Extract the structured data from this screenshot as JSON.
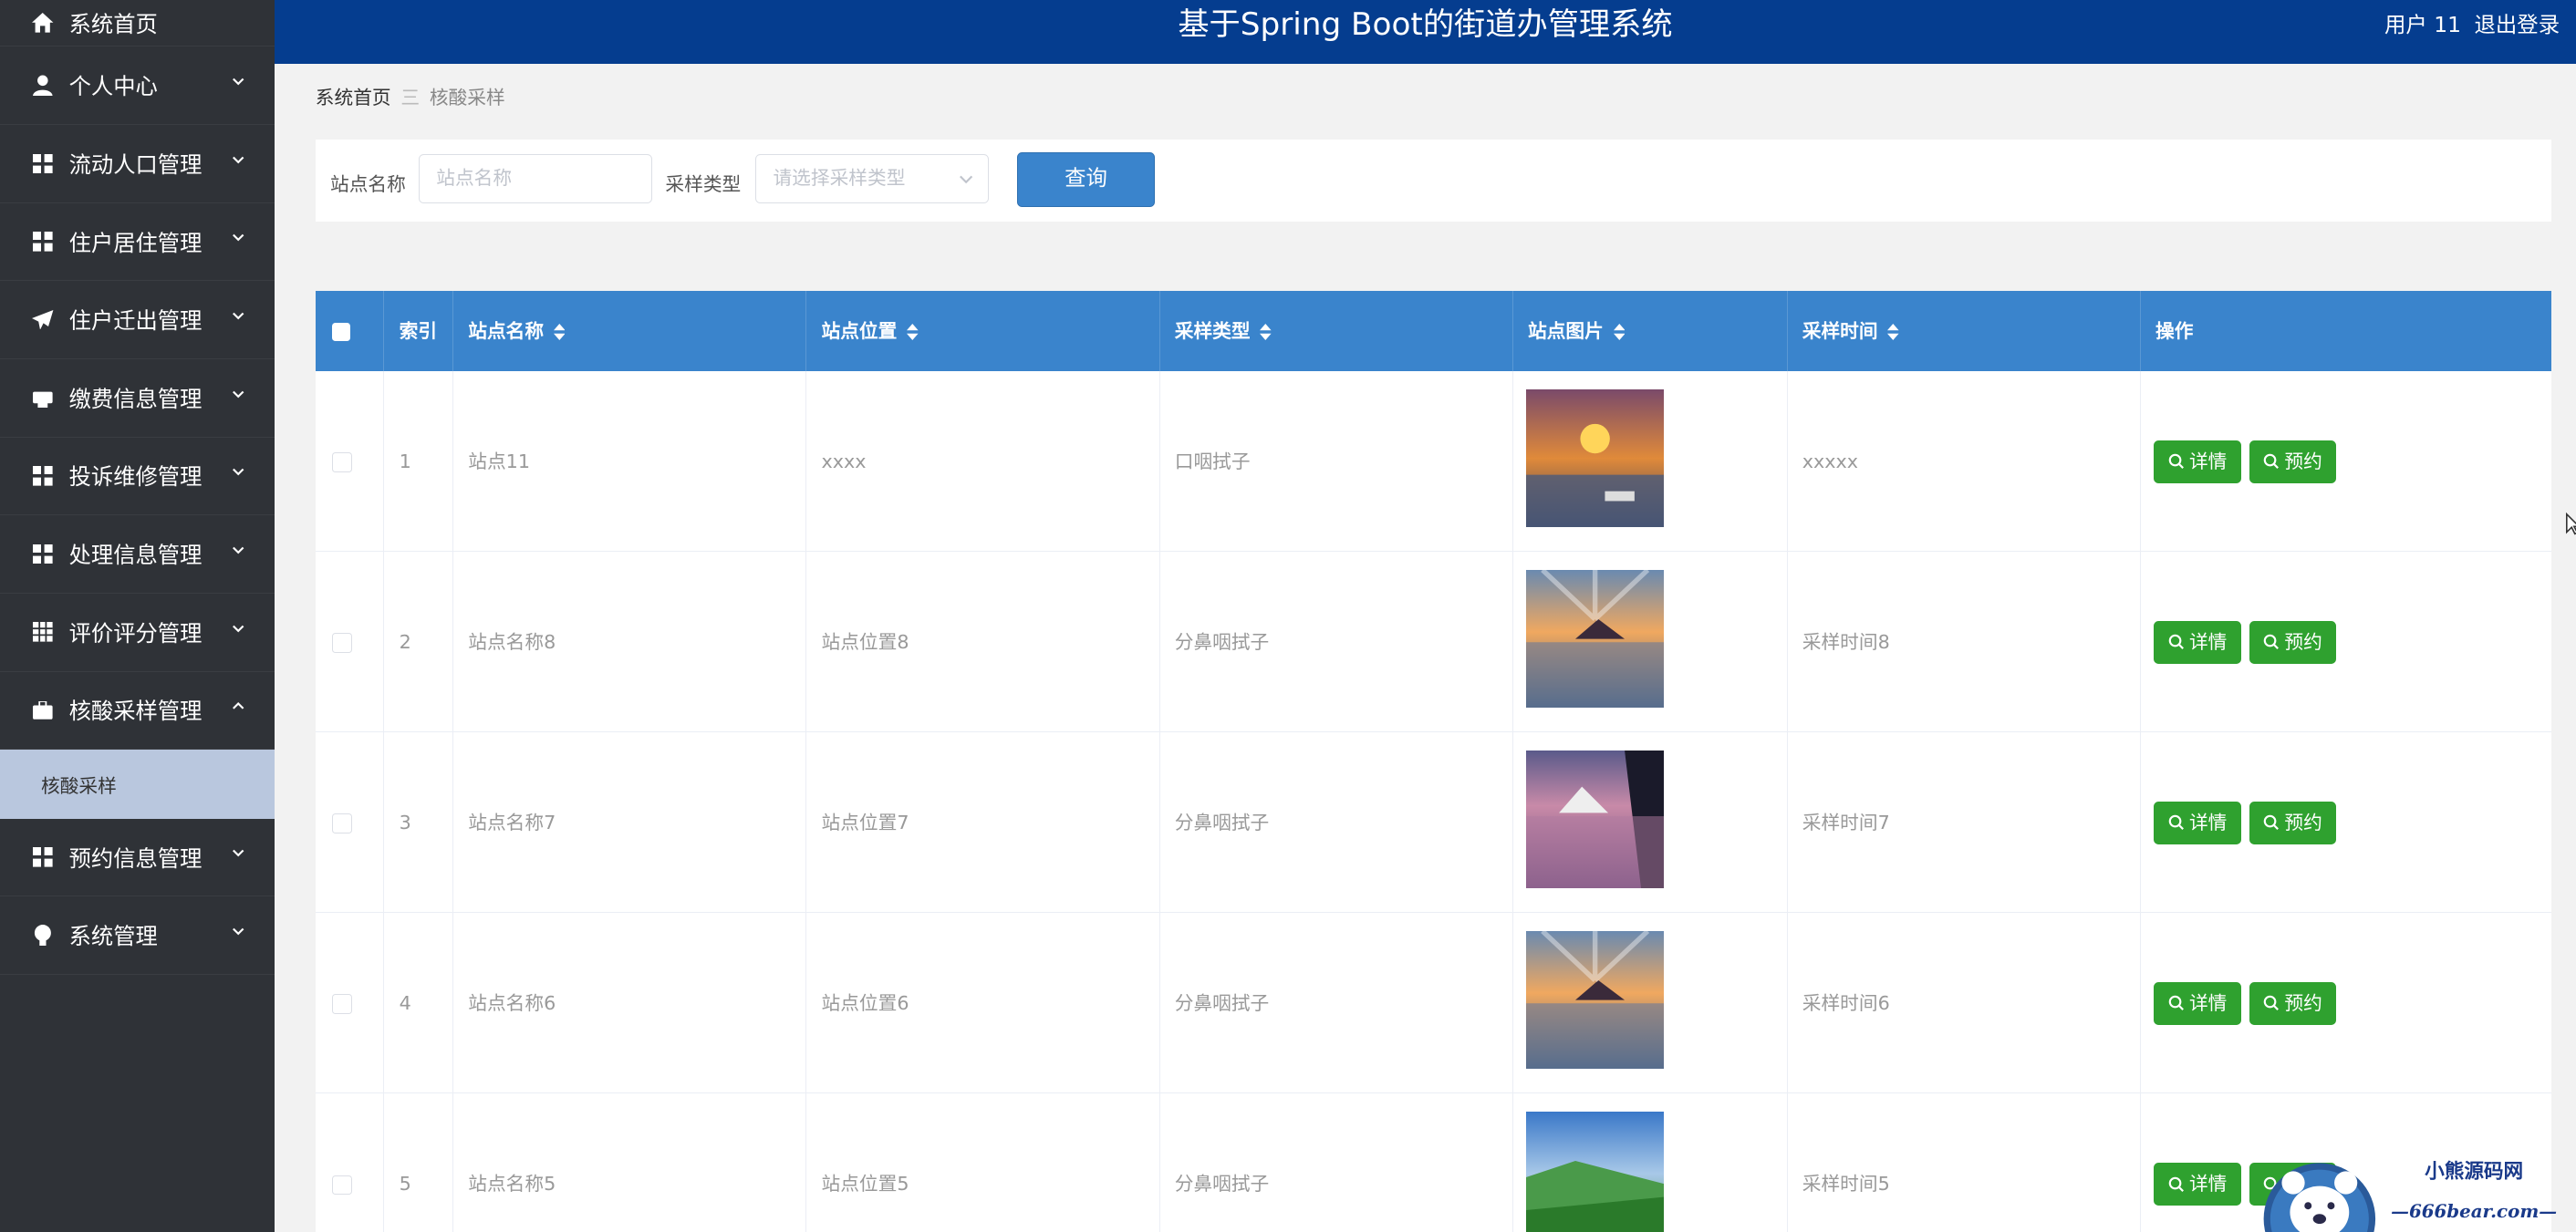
{
  "header": {
    "title": "基于Spring Boot的街道办管理系统",
    "user": "用户 11",
    "logout": "退出登录"
  },
  "sidebar": {
    "items": [
      {
        "label": "系统首页",
        "icon": "home-icon"
      },
      {
        "label": "个人中心",
        "icon": "user-icon"
      },
      {
        "label": "流动人口管理",
        "icon": "grid-icon"
      },
      {
        "label": "住户居住管理",
        "icon": "grid-icon"
      },
      {
        "label": "住户迁出管理",
        "icon": "send-icon"
      },
      {
        "label": "缴费信息管理",
        "icon": "print-icon"
      },
      {
        "label": "投诉维修管理",
        "icon": "grid-icon"
      },
      {
        "label": "处理信息管理",
        "icon": "grid-icon"
      },
      {
        "label": "评价评分管理",
        "icon": "table-icon"
      },
      {
        "label": "核酸采样管理",
        "icon": "briefcase-icon",
        "expanded": true
      },
      {
        "label": "预约信息管理",
        "icon": "grid-icon"
      },
      {
        "label": "系统管理",
        "icon": "bulb-icon"
      }
    ],
    "sub_item": "核酸采样"
  },
  "breadcrumb": {
    "home": "系统首页",
    "sep": "三",
    "current": "核酸采样"
  },
  "search": {
    "name_label": "站点名称",
    "name_placeholder": "站点名称",
    "type_label": "采样类型",
    "type_placeholder": "请选择采样类型",
    "query_button": "查询"
  },
  "table": {
    "columns": [
      "索引",
      "站点名称",
      "站点位置",
      "采样类型",
      "站点图片",
      "采样时间",
      "操作"
    ],
    "rows": [
      {
        "index": "1",
        "name": "站点11",
        "location": "xxxx",
        "type": "口咽拭子",
        "time": "xxxxx"
      },
      {
        "index": "2",
        "name": "站点名称8",
        "location": "站点位置8",
        "type": "分鼻咽拭子",
        "time": "采样时间8"
      },
      {
        "index": "3",
        "name": "站点名称7",
        "location": "站点位置7",
        "type": "分鼻咽拭子",
        "time": "采样时间7"
      },
      {
        "index": "4",
        "name": "站点名称6",
        "location": "站点位置6",
        "type": "分鼻咽拭子",
        "time": "采样时间6"
      },
      {
        "index": "5",
        "name": "站点名称5",
        "location": "站点位置5",
        "type": "分鼻咽拭子",
        "time": "采样时间5"
      }
    ],
    "detail_button": "详情",
    "reserve_button": "预约"
  },
  "watermark": {
    "name": "小熊源码网",
    "url": "—666bear.com—"
  },
  "colors": {
    "header": "#053d8f",
    "sidebar": "#2f3237",
    "table_head": "#3a84cc",
    "action": "#2fa12f"
  }
}
